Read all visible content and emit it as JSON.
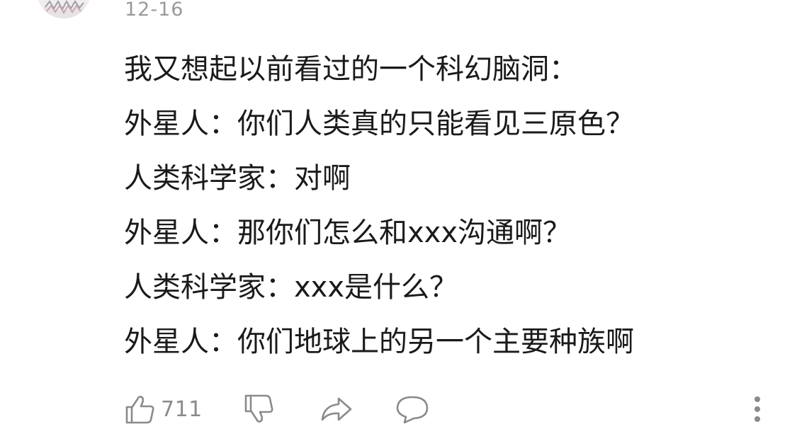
{
  "comment": {
    "date": "12-16",
    "lines": [
      "我又想起以前看过的一个科幻脑洞：",
      "外星人：你们人类真的只能看见三原色？",
      "人类科学家：对啊",
      "外星人：那你们怎么和xxx沟通啊？",
      "人类科学家：xxx是什么？",
      "外星人：你们地球上的另一个主要种族啊"
    ]
  },
  "actions": {
    "like_count": "711",
    "icons": [
      "thumbs-up-icon",
      "thumbs-down-icon",
      "share-icon",
      "comment-icon",
      "more-vertical-icon"
    ]
  },
  "colors": {
    "text": "#1a1a1a",
    "muted": "#9a9a9a",
    "icon": "#8a8a8a"
  }
}
